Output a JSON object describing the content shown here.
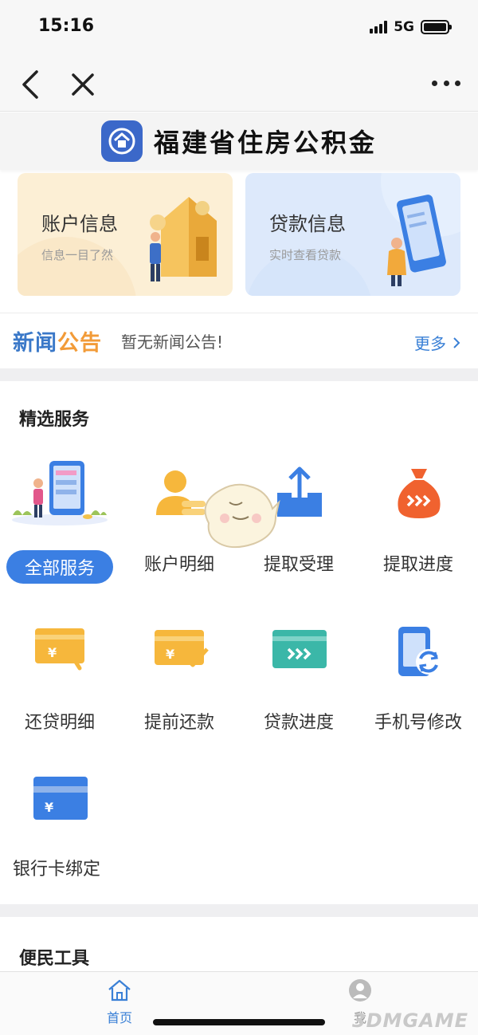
{
  "status_bar": {
    "time": "15:16",
    "network": "5G"
  },
  "header": {
    "title": "福建省住房公积金"
  },
  "cards": [
    {
      "title": "账户信息",
      "subtitle": "信息一目了然"
    },
    {
      "title": "贷款信息",
      "subtitle": "实时查看贷款"
    }
  ],
  "news": {
    "label_part1": "新闻",
    "label_part2": "公告",
    "text": "暂无新闻公告!",
    "more": "更多"
  },
  "featured": {
    "title": "精选服务",
    "all_services": "全部服务",
    "items": [
      {
        "label": "账户明细",
        "icon": "account-detail-icon"
      },
      {
        "label": "提取受理",
        "icon": "withdraw-upload-icon"
      },
      {
        "label": "提取进度",
        "icon": "money-bag-icon"
      },
      {
        "label": "还贷明细",
        "icon": "yen-card-return-icon"
      },
      {
        "label": "提前还款",
        "icon": "yen-card-check-icon"
      },
      {
        "label": "贷款进度",
        "icon": "card-progress-icon"
      },
      {
        "label": "手机号修改",
        "icon": "phone-refresh-icon"
      },
      {
        "label": "银行卡绑定",
        "icon": "bank-card-icon"
      }
    ]
  },
  "tools": {
    "title": "便民工具"
  },
  "tabbar": {
    "home": "首页",
    "me": "我"
  },
  "watermark": "3DMGAME",
  "colors": {
    "accent": "#3b7fe3",
    "orange": "#f29b38",
    "news_blue": "#3a78c8"
  }
}
